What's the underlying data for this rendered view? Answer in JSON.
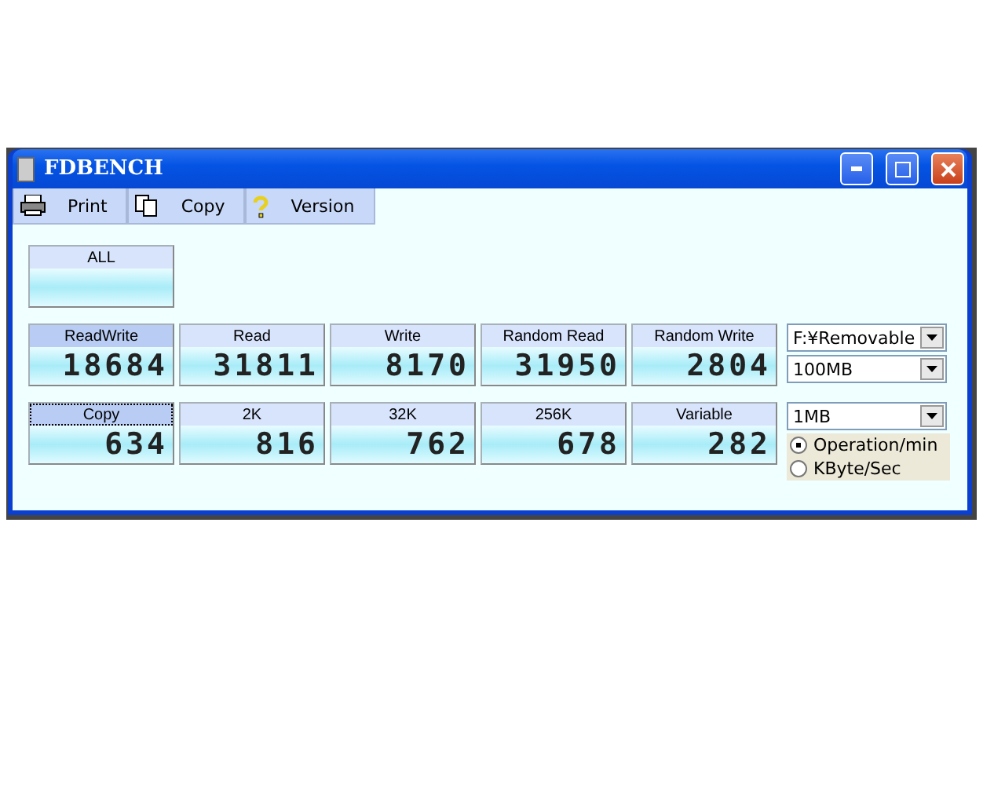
{
  "window": {
    "title": "FDBENCH"
  },
  "toolbar": [
    {
      "kind": "print",
      "label": "Print"
    },
    {
      "kind": "copy",
      "label": "Copy"
    },
    {
      "kind": "help",
      "label": "Version"
    }
  ],
  "all_button": {
    "label": "ALL",
    "selected": false
  },
  "rows": [
    [
      {
        "label": "ReadWrite",
        "value": "18684",
        "selected": true,
        "focused": false
      },
      {
        "label": "Read",
        "value": "31811",
        "selected": false,
        "focused": false
      },
      {
        "label": "Write",
        "value": "8170",
        "selected": false,
        "focused": false
      },
      {
        "label": "Random Read",
        "value": "31950",
        "selected": false,
        "focused": false
      },
      {
        "label": "Random Write",
        "value": "2804",
        "selected": false,
        "focused": false
      }
    ],
    [
      {
        "label": "Copy",
        "value": "634",
        "selected": true,
        "focused": true
      },
      {
        "label": "2K",
        "value": "816",
        "selected": false,
        "focused": false
      },
      {
        "label": "32K",
        "value": "762",
        "selected": false,
        "focused": false
      },
      {
        "label": "256K",
        "value": "678",
        "selected": false,
        "focused": false
      },
      {
        "label": "Variable",
        "value": "282",
        "selected": false,
        "focused": false
      }
    ]
  ],
  "drive_select": "F:¥Removable",
  "size_select": "100MB",
  "block_select": "1MB",
  "units": [
    {
      "label": "Operation/min",
      "selected": true
    },
    {
      "label": "KByte/Sec",
      "selected": false
    }
  ]
}
